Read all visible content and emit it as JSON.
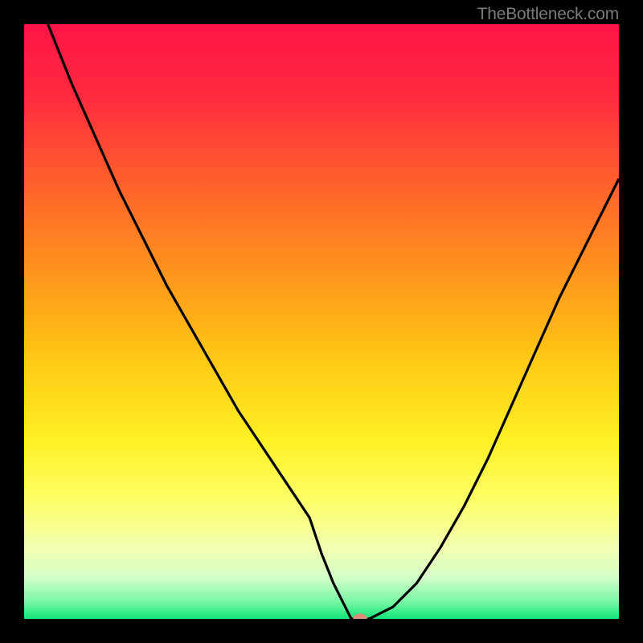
{
  "watermark": "TheBottleneck.com",
  "chart_data": {
    "type": "line",
    "title": "",
    "xlabel": "",
    "ylabel": "",
    "xlim": [
      0,
      100
    ],
    "ylim": [
      0,
      100
    ],
    "background": {
      "type": "vertical_gradient",
      "stops": [
        {
          "pos": 0.0,
          "color": "#ff1447"
        },
        {
          "pos": 0.12,
          "color": "#ff2a3f"
        },
        {
          "pos": 0.25,
          "color": "#ff5a2d"
        },
        {
          "pos": 0.4,
          "color": "#ff8e1e"
        },
        {
          "pos": 0.55,
          "color": "#ffc414"
        },
        {
          "pos": 0.7,
          "color": "#fff024"
        },
        {
          "pos": 0.8,
          "color": "#fdff66"
        },
        {
          "pos": 0.88,
          "color": "#f3ffb0"
        },
        {
          "pos": 0.93,
          "color": "#d4ffc8"
        },
        {
          "pos": 0.97,
          "color": "#7bf7a6"
        },
        {
          "pos": 1.0,
          "color": "#14e578"
        }
      ]
    },
    "series": [
      {
        "name": "bottleneck-curve",
        "color": "#000000",
        "x": [
          4,
          8,
          12,
          16,
          20,
          24,
          28,
          32,
          36,
          40,
          44,
          48,
          50,
          52,
          54,
          55,
          58,
          62,
          66,
          70,
          74,
          78,
          82,
          86,
          90,
          94,
          98,
          100
        ],
        "y": [
          100,
          90,
          81,
          72,
          64,
          56,
          49,
          42,
          35,
          29,
          23,
          17,
          11,
          6,
          2,
          0,
          0,
          2,
          6,
          12,
          19,
          27,
          36,
          45,
          54,
          62,
          70,
          74
        ]
      }
    ],
    "marker": {
      "name": "selected-point",
      "x": 56.5,
      "y": 0,
      "color": "#d98d7a",
      "rx": 1.2,
      "ry": 0.9
    }
  }
}
